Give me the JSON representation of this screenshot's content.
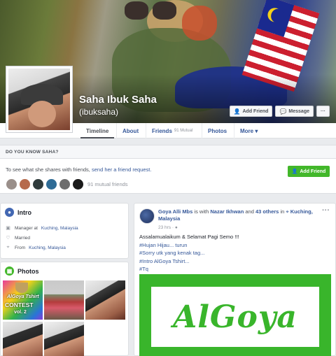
{
  "profile": {
    "name": "Saha Ibuk Saha",
    "handle": "(ibuksaha)",
    "buttons": {
      "add_friend": "Add Friend",
      "message": "Message",
      "more": "···"
    }
  },
  "tabs": [
    {
      "label": "Timeline",
      "active": true
    },
    {
      "label": "About"
    },
    {
      "label": "Friends",
      "badge": "91 Mutual"
    },
    {
      "label": "Photos"
    },
    {
      "label": "More ▾"
    }
  ],
  "know": {
    "heading": "DO YOU KNOW SAHA?",
    "text_prefix": "To see what she shares with friends,",
    "text_link": "send her a friend request.",
    "add_friend": "Add Friend",
    "mutual_count": "91 mutual friends"
  },
  "intro": {
    "title": "Intro",
    "items": [
      {
        "icon": "briefcase-icon",
        "prefix": "Manager at",
        "link": "Kuching, Malaysia"
      },
      {
        "icon": "heart-icon",
        "prefix": "Married",
        "link": ""
      },
      {
        "icon": "location-pin-icon",
        "prefix": "From",
        "link": "Kuching, Malaysia"
      }
    ]
  },
  "photos": {
    "title": "Photos",
    "contest": {
      "line1": "AlGoya Tshirt",
      "line2": "CONTEST",
      "line3": "vol. 2"
    }
  },
  "post": {
    "author": "Goya Alli Mbs",
    "with_text": "is with",
    "tagged": "Nazar Ikhwan",
    "and_text": "and",
    "others": "43 others",
    "in_text": "in",
    "place": "Kuching, Malaysia",
    "time": "23 hrs · ",
    "menu": "···",
    "lines": [
      {
        "text": "Assalamualaikum & Selamat Pagi Semo !!!",
        "tag": false
      },
      {
        "text": "#Hujan Hijau... turun",
        "tag": true
      },
      {
        "text": "#Sorry utk yang kenak tag...",
        "tag": true
      },
      {
        "text": "#Intro AlGoya Tshirt...",
        "tag": true
      },
      {
        "text": "#Tq",
        "tag": true
      }
    ],
    "image_word": "AlGoya"
  },
  "colors": {
    "brand_blue": "#365899",
    "green": "#42b72a",
    "algoya_green": "#39b52b"
  }
}
